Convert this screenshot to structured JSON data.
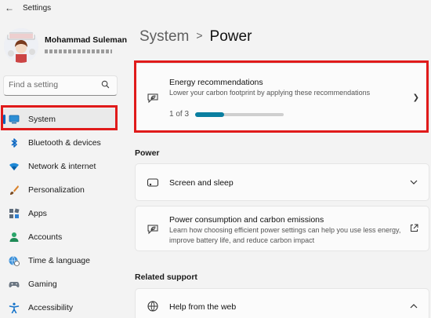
{
  "window": {
    "title": "Settings",
    "back_icon": "back-arrow-icon"
  },
  "user": {
    "name": "Mohammad Suleman"
  },
  "search": {
    "placeholder": "Find a setting"
  },
  "sidebar": {
    "items": [
      {
        "label": "System",
        "icon": "system-icon",
        "selected": true
      },
      {
        "label": "Bluetooth & devices",
        "icon": "bluetooth-icon"
      },
      {
        "label": "Network & internet",
        "icon": "wifi-icon"
      },
      {
        "label": "Personalization",
        "icon": "brush-icon"
      },
      {
        "label": "Apps",
        "icon": "apps-icon"
      },
      {
        "label": "Accounts",
        "icon": "person-icon"
      },
      {
        "label": "Time & language",
        "icon": "globe-clock-icon"
      },
      {
        "label": "Gaming",
        "icon": "gamepad-icon"
      },
      {
        "label": "Accessibility",
        "icon": "accessibility-icon"
      }
    ]
  },
  "breadcrumb": {
    "parent": "System",
    "separator": ">",
    "current": "Power"
  },
  "energy_card": {
    "title": "Energy recommendations",
    "description": "Lower your carbon footprint by applying these recommendations",
    "progress_text": "1 of 3",
    "progress_fraction": 0.33
  },
  "power_section": {
    "heading": "Power",
    "screen_sleep": {
      "title": "Screen and sleep"
    },
    "consumption": {
      "title": "Power consumption and carbon emissions",
      "description": "Learn how choosing efficient power settings can help you use less energy, improve battery life, and reduce carbon impact"
    }
  },
  "related_support": {
    "heading": "Related support",
    "help_web": {
      "title": "Help from the web"
    }
  },
  "colors": {
    "accent": "#0067c0",
    "highlight_red": "#e01a1a",
    "progress": "#0a7fa0"
  }
}
